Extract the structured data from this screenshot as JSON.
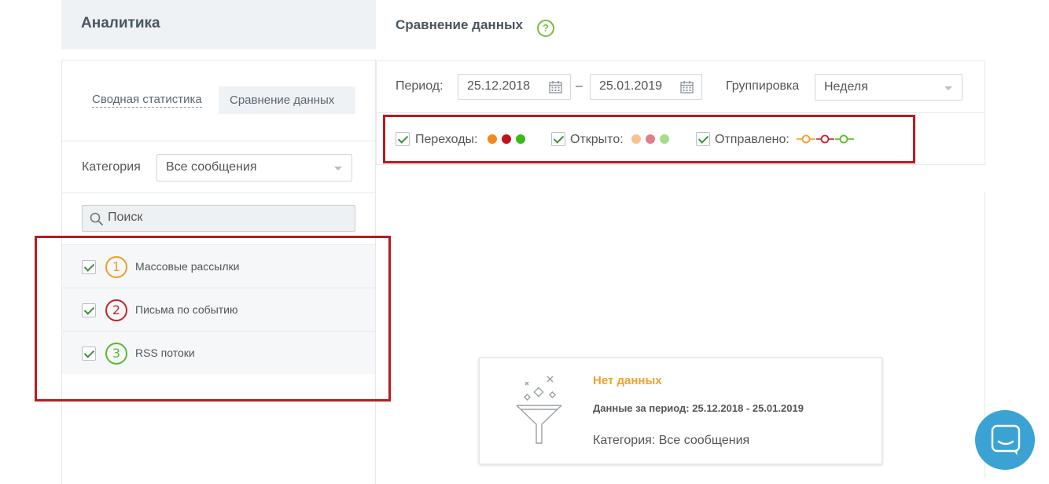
{
  "left": {
    "title": "Аналитика",
    "tabs": {
      "summary": "Сводная статистика",
      "compare": "Сравнение данных"
    },
    "category": {
      "label": "Категория",
      "value": "Все сообщения"
    },
    "search": {
      "placeholder": "Поиск"
    },
    "items": [
      {
        "number": "1",
        "label": "Массовые рассылки",
        "color": "#f39c2a",
        "checked": true
      },
      {
        "number": "2",
        "label": "Письма по событию",
        "color": "#c0262d",
        "checked": true
      },
      {
        "number": "3",
        "label": "RSS потоки",
        "color": "#5cb82e",
        "checked": true
      }
    ]
  },
  "right": {
    "title": "Сравнение данных",
    "help": "?",
    "period": {
      "label": "Период:",
      "from": "25.12.2018",
      "separator": "–",
      "to": "25.01.2019"
    },
    "grouping": {
      "label": "Группировка",
      "value": "Неделя"
    },
    "legend": [
      {
        "label": "Переходы:",
        "style": "solid",
        "colors": [
          "#f08a1c",
          "#c0111f",
          "#3cb817"
        ]
      },
      {
        "label": "Открыто:",
        "style": "faded",
        "colors": [
          "#f7c48e",
          "#df7f88",
          "#a6dd8c"
        ]
      },
      {
        "label": "Отправлено:",
        "style": "ring-line",
        "colors": [
          "#f39c2a",
          "#c0262d",
          "#5cb82e"
        ]
      }
    ],
    "empty": {
      "title": "Нет данных",
      "period": "Данные за период: 25.12.2018 - 25.01.2019",
      "category": "Категория: Все сообщения"
    }
  },
  "colors": {
    "accent_green": "#7dbb3c",
    "highlight_red": "#b51d22",
    "chat_blue": "#3aa3d4",
    "empty_orange": "#f0a030"
  }
}
